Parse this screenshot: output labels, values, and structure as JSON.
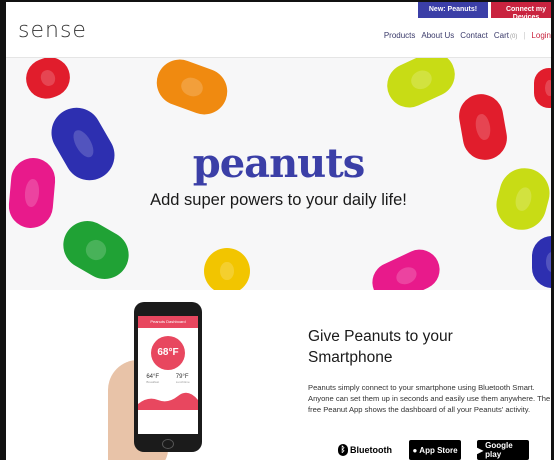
{
  "header": {
    "logo": "sense",
    "top_buttons": {
      "new_peanuts": "New: Peanuts!",
      "connect": "Connect my Devices"
    },
    "nav": [
      {
        "label": "Products"
      },
      {
        "label": "About Us"
      },
      {
        "label": "Contact"
      },
      {
        "label": "Cart",
        "count": "(0)"
      },
      {
        "label": "Login"
      }
    ]
  },
  "hero": {
    "brand": "peanuts",
    "tagline": "Add super powers to your daily life!",
    "pill_colors": [
      "#e11d2c",
      "#2d2fb0",
      "#f08a10",
      "#20a235",
      "#e81a8b",
      "#c8dc15",
      "#f2c500",
      "#1f2fb5"
    ]
  },
  "phone": {
    "app_title": "Peanuts Dashboard",
    "main_temp": "68°F",
    "low": "64°F",
    "high": "79°F",
    "low_label": "Breakfast",
    "high_label": "Lunchtime"
  },
  "section": {
    "title": "Give Peanuts to your Smartphone",
    "body": "Peanuts simply connect to your smartphone using Bluetooth Smart. Anyone can set them up in seconds and easily use them anywhere. The free Peanut App shows the dashboard of all your Peanuts' activity.",
    "badges": {
      "bluetooth": "Bluetooth",
      "bluetooth_sub": "SMART",
      "appstore": "App Store",
      "googleplay": "Google play"
    }
  }
}
